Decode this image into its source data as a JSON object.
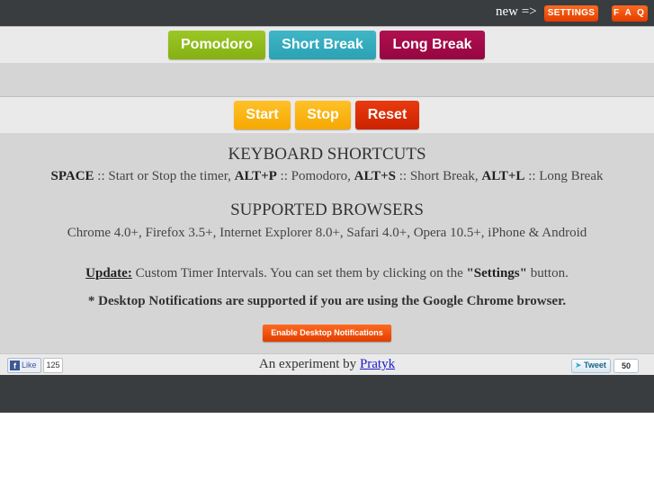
{
  "topbar": {
    "new_label": "new =>",
    "settings_label": "SETTINGS",
    "faq_label": "F A Q"
  },
  "modes": {
    "pomodoro": "Pomodoro",
    "short_break": "Short Break",
    "long_break": "Long Break"
  },
  "controls": {
    "start": "Start",
    "stop": "Stop",
    "reset": "Reset"
  },
  "shortcuts": {
    "heading": "KEYBOARD SHORTCUTS",
    "space_key": "SPACE",
    "space_desc": " :: Start or Stop the timer, ",
    "altp_key": "ALT+P",
    "altp_desc": " :: Pomodoro, ",
    "alts_key": "ALT+S",
    "alts_desc": " :: Short Break, ",
    "altl_key": "ALT+L",
    "altl_desc": " :: Long Break"
  },
  "browsers": {
    "heading": "SUPPORTED BROWSERS",
    "list": "Chrome 4.0+, Firefox 3.5+, Internet Explorer 8.0+, Safari 4.0+, Opera 10.5+, iPhone & Android"
  },
  "update": {
    "label": "Update:",
    "text_before": " Custom Timer Intervals. You can set them by clicking on the ",
    "settings_quote": "\"Settings\"",
    "text_after": " button."
  },
  "notifications": {
    "note": "* Desktop Notifications are supported if you are using the Google Chrome browser.",
    "enable_button": "Enable Desktop Notifications"
  },
  "footer": {
    "fb_icon": "f",
    "like_label": "Like",
    "like_count": "125",
    "credit_text": "An experiment by ",
    "credit_link": "Pratyk",
    "tweet_label": "Tweet",
    "tweet_count": "50"
  },
  "colors": {
    "pomodoro": "#8fbc1a",
    "short_break": "#35adc0",
    "long_break": "#a80b49",
    "start_stop": "#fbb415",
    "reset": "#dd2f06",
    "accent_orange": "#f05010",
    "bar_dark": "#3a3d40"
  },
  "icons": {
    "facebook": "facebook-icon",
    "twitter": "twitter-bird-icon"
  }
}
